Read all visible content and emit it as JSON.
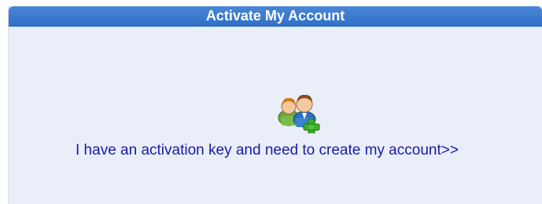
{
  "header": {
    "title": "Activate My Account"
  },
  "main": {
    "icon": "add-user-icon",
    "link_text": "I have an activation key and need to create my account>>"
  },
  "colors": {
    "header_bg": "#3a78cc",
    "panel_bg": "#eaeef8",
    "link": "#1a1aa6"
  }
}
